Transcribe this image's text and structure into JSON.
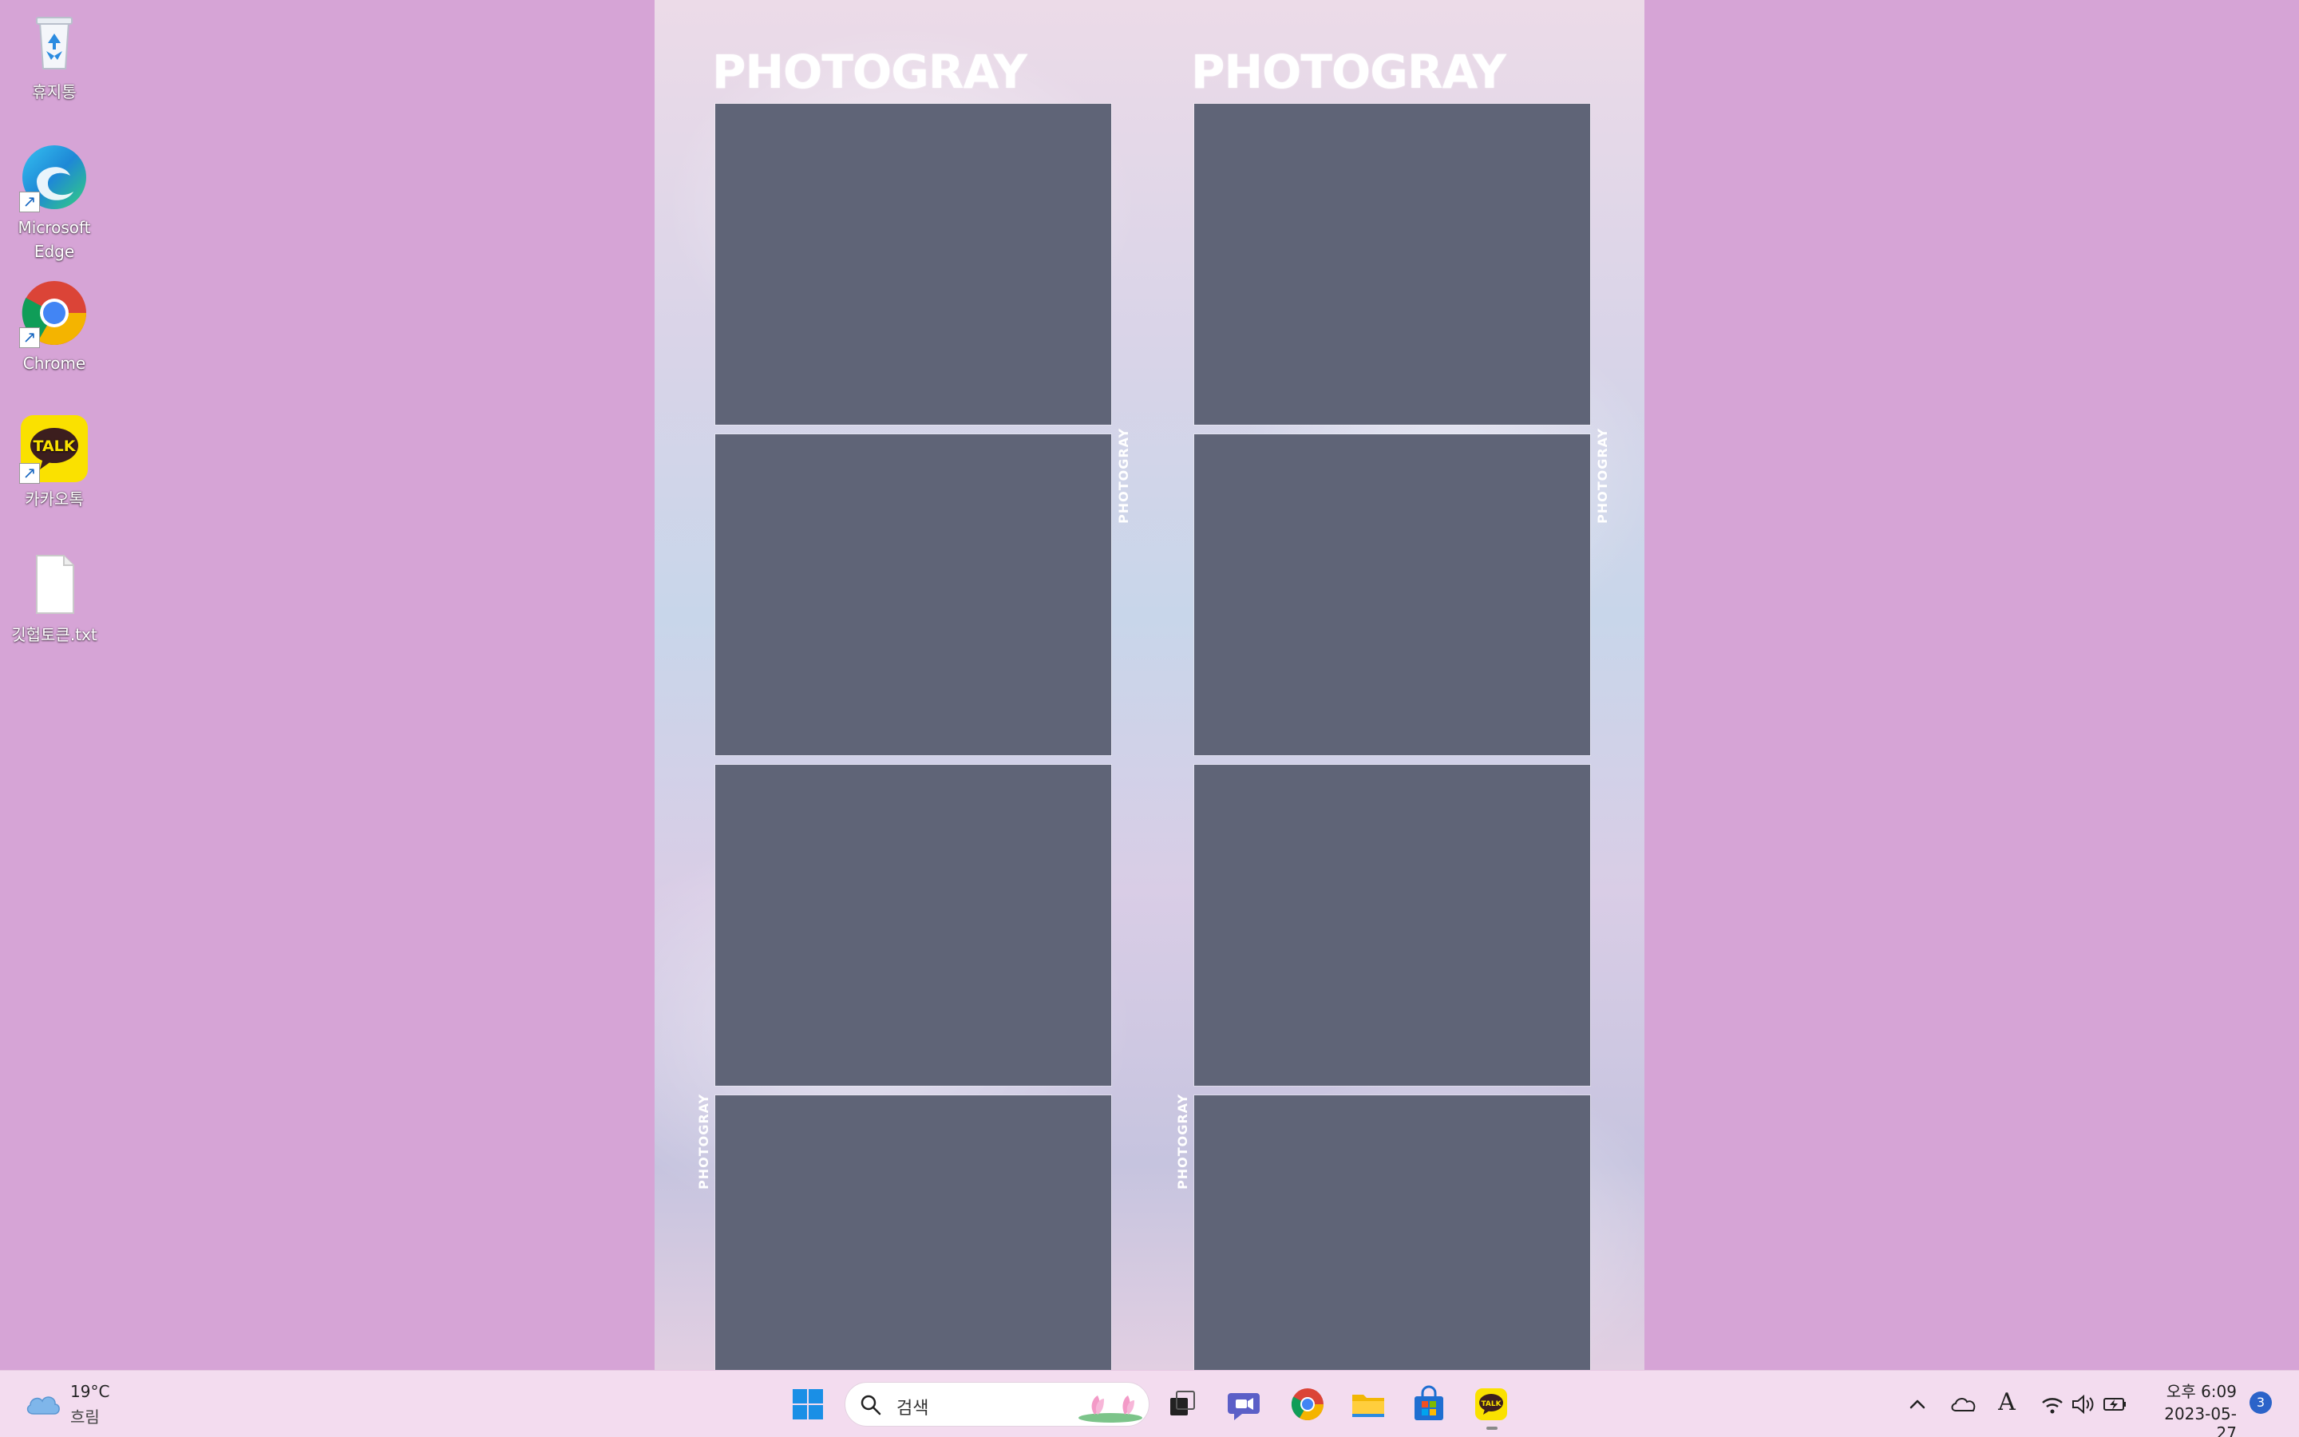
{
  "desktop": {
    "background_color": "#d6a4d6",
    "icons": [
      {
        "label": "휴지통",
        "icon": "recycle-bin-icon"
      },
      {
        "label": "Microsoft Edge",
        "icon": "edge-icon"
      },
      {
        "label": "Chrome",
        "icon": "chrome-icon"
      },
      {
        "label": "카카오톡",
        "icon": "kakaotalk-icon"
      },
      {
        "label": "깃헙토큰.txt",
        "icon": "text-file-icon"
      }
    ]
  },
  "photo_strip": {
    "brand_left": "PHOTOGRAY",
    "brand_right": "PHOTOGRAY",
    "side_brand": "PHOTOGRAY",
    "frames": 8
  },
  "taskbar": {
    "weather": {
      "temp": "19°C",
      "condition": "흐림"
    },
    "search": {
      "placeholder": "검색"
    },
    "apps": [
      "start-icon",
      "task-view-icon",
      "teams-chat-icon",
      "chrome-icon",
      "file-explorer-icon",
      "microsoft-store-icon",
      "kakaotalk-icon"
    ],
    "tray": {
      "ime": "A"
    },
    "clock": {
      "time": "오후 6:09",
      "date": "2023-05-27"
    },
    "notification_count": "3"
  },
  "colors": {
    "taskbar_bg": "#f3dcef",
    "accent": "#2b63c9",
    "kakao_yellow": "#fae100"
  }
}
